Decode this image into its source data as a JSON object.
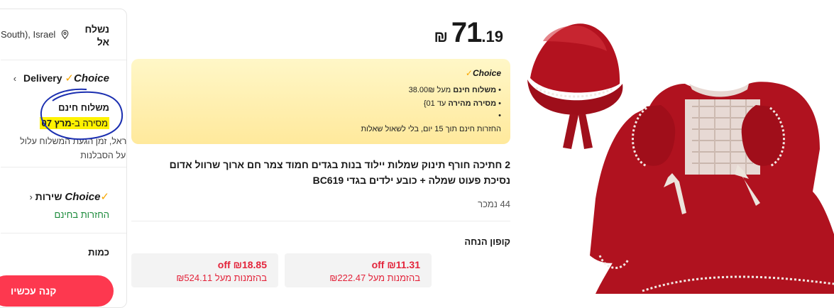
{
  "shipping": {
    "ship_to_label": "נשלח אל",
    "ship_to_value": "South), Israel"
  },
  "delivery": {
    "choice_brand": "Choice",
    "delivery_label": "Delivery",
    "free_shipping": "משלוח חינם",
    "date_prefix": "מסירה ב-",
    "date_value": "מרץ 07",
    "note": "עקב המצב בישראל, זמן הגעת המשלוח עלול להתעכב. תודה על הסבלנות"
  },
  "service": {
    "choice_brand": "Choice",
    "label": "שירות",
    "free_returns": "החזרות בחינם"
  },
  "quantity_label": "כמות",
  "buy_button": "קנה עכשיו",
  "price": {
    "currency": "₪",
    "integer": "71",
    "decimal": ".19"
  },
  "choice_box": {
    "brand": "Choice",
    "line1_min": "מעל 38.00₪",
    "line1_label": "משלוח חינם",
    "line2_label": "מסירה מהירה",
    "line2_rest": "עד 01}",
    "line4": "החזרות חינם תוך 15 יום, בלי לשאול שאלות"
  },
  "product": {
    "title": "2 חתיכה חורף תינוק שמלות יילוד בנות בגדים חמוד צמר חם ארוך שרוול אדום נסיכת פעוט שמלה + כובע ילדים בגדי BC619",
    "sold": "44 נמכר"
  },
  "coupons": {
    "label": "קופון הנחה",
    "items": [
      {
        "amount": "₪11.31 off",
        "condition": "בהזמנות מעל ₪222.47"
      },
      {
        "amount": "₪18.85 off",
        "condition": "בהזמנות מעל ₪524.11"
      }
    ]
  },
  "colors": {
    "accent_red": "#fd384f",
    "coupon_red": "#e3243b",
    "choice_orange": "#f7a600",
    "success_green": "#1a8a3a",
    "highlight_yellow": "#fff200",
    "annotation_blue": "#1b2fb0"
  },
  "icons": [
    "location-pin-icon",
    "chevron-left-icon",
    "choice-check-icon"
  ]
}
